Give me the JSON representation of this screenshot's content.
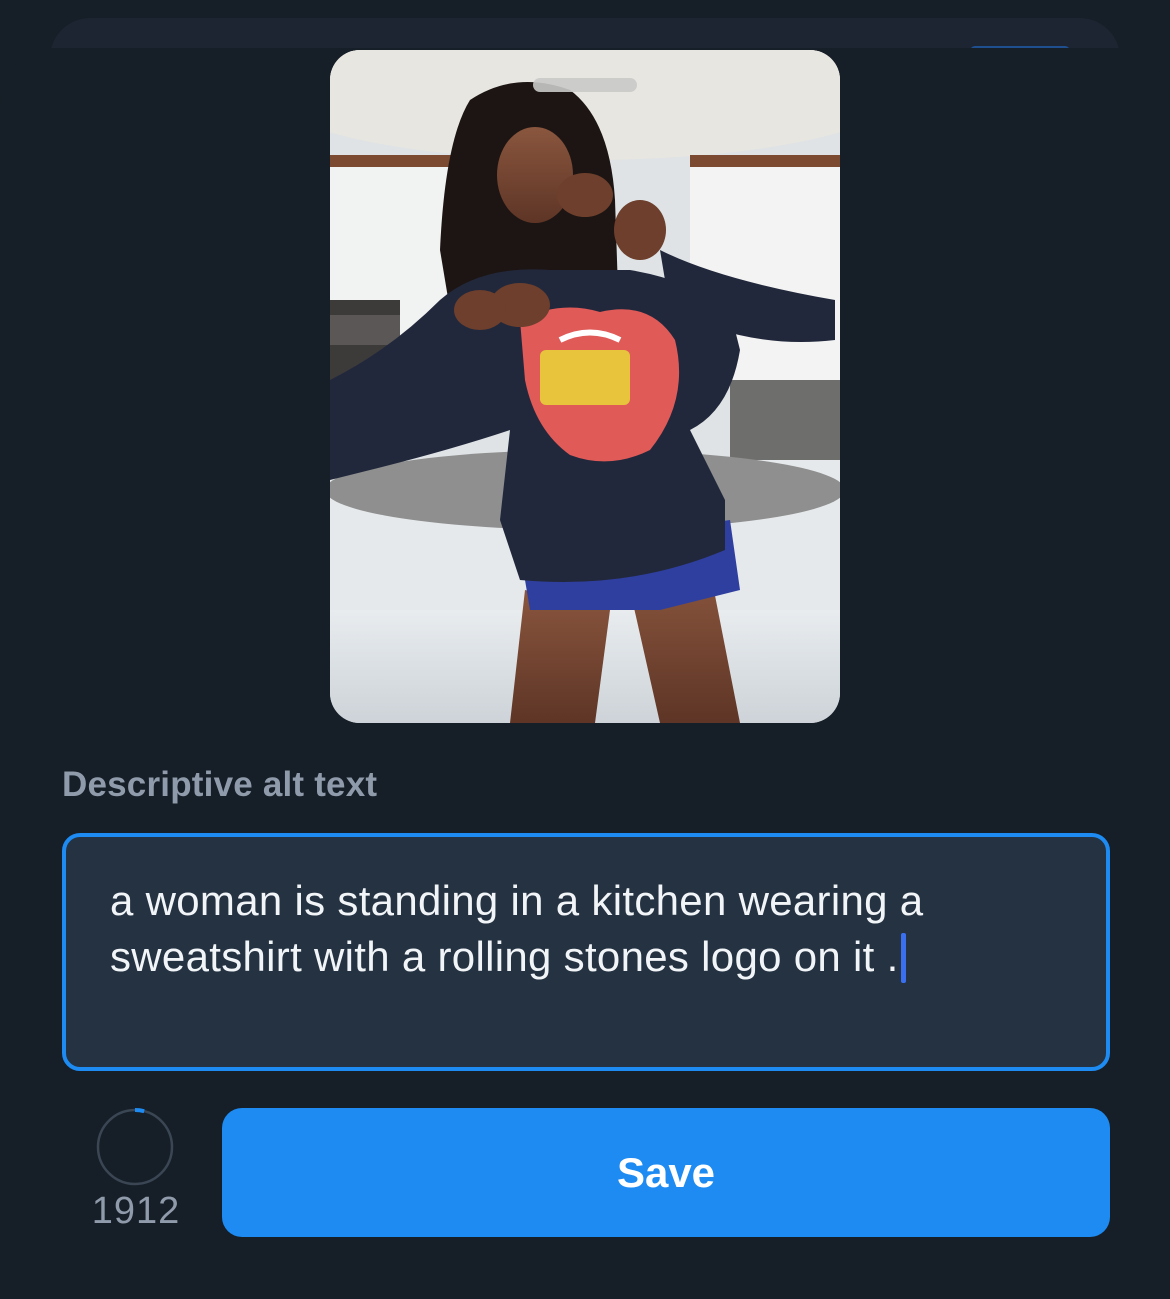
{
  "alt_editor": {
    "label": "Descriptive alt text",
    "text": "a woman is standing in a kitchen wearing a sweatshirt with a rolling stones logo on it .",
    "remaining_characters": "1912",
    "character_usage_fraction": 0.04,
    "save_label": "Save"
  },
  "colors": {
    "accent": "#1d8bf2",
    "background": "#161e27",
    "input_background": "#243242",
    "muted_text": "#8f9bab"
  },
  "icons": {
    "counter": "character-count-ring-icon"
  }
}
